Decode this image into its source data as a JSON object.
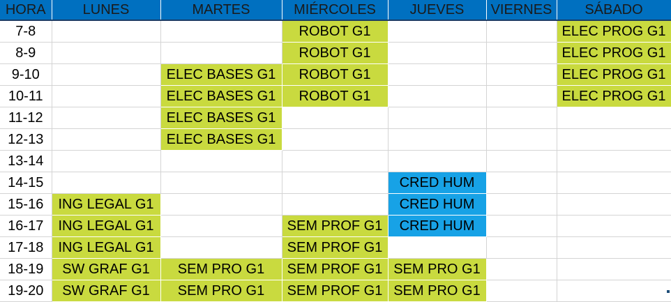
{
  "colors": {
    "header": "#0070c0",
    "green": "#c9da3f",
    "blue": "#17a2e6",
    "grid": "#d4d4d4"
  },
  "columns": [
    "HORA",
    "LUNES",
    "MARTES",
    "MIÉRCOLES",
    "JUEVES",
    "VIERNES",
    "SÁBADO"
  ],
  "rows": [
    {
      "hour": "7-8",
      "cells": [
        {
          "t": "",
          "c": ""
        },
        {
          "t": "",
          "c": ""
        },
        {
          "t": "ROBOT G1",
          "c": "green"
        },
        {
          "t": "",
          "c": ""
        },
        {
          "t": "",
          "c": ""
        },
        {
          "t": "ELEC PROG G1",
          "c": "green"
        }
      ]
    },
    {
      "hour": "8-9",
      "cells": [
        {
          "t": "",
          "c": ""
        },
        {
          "t": "",
          "c": ""
        },
        {
          "t": "ROBOT G1",
          "c": "green"
        },
        {
          "t": "",
          "c": ""
        },
        {
          "t": "",
          "c": ""
        },
        {
          "t": "ELEC PROG G1",
          "c": "green"
        }
      ]
    },
    {
      "hour": "9-10",
      "cells": [
        {
          "t": "",
          "c": ""
        },
        {
          "t": "ELEC BASES G1",
          "c": "green"
        },
        {
          "t": "ROBOT G1",
          "c": "green"
        },
        {
          "t": "",
          "c": ""
        },
        {
          "t": "",
          "c": ""
        },
        {
          "t": "ELEC PROG G1",
          "c": "green"
        }
      ]
    },
    {
      "hour": "10-11",
      "cells": [
        {
          "t": "",
          "c": ""
        },
        {
          "t": "ELEC BASES G1",
          "c": "green"
        },
        {
          "t": "ROBOT G1",
          "c": "green"
        },
        {
          "t": "",
          "c": ""
        },
        {
          "t": "",
          "c": ""
        },
        {
          "t": "ELEC PROG G1",
          "c": "green"
        }
      ]
    },
    {
      "hour": "11-12",
      "cells": [
        {
          "t": "",
          "c": ""
        },
        {
          "t": "ELEC BASES G1",
          "c": "green"
        },
        {
          "t": "",
          "c": ""
        },
        {
          "t": "",
          "c": ""
        },
        {
          "t": "",
          "c": ""
        },
        {
          "t": "",
          "c": ""
        }
      ]
    },
    {
      "hour": "12-13",
      "cells": [
        {
          "t": "",
          "c": ""
        },
        {
          "t": "ELEC BASES G1",
          "c": "green"
        },
        {
          "t": "",
          "c": ""
        },
        {
          "t": "",
          "c": ""
        },
        {
          "t": "",
          "c": ""
        },
        {
          "t": "",
          "c": ""
        }
      ]
    },
    {
      "hour": "13-14",
      "cells": [
        {
          "t": "",
          "c": ""
        },
        {
          "t": "",
          "c": ""
        },
        {
          "t": "",
          "c": ""
        },
        {
          "t": "",
          "c": ""
        },
        {
          "t": "",
          "c": ""
        },
        {
          "t": "",
          "c": ""
        }
      ]
    },
    {
      "hour": "14-15",
      "cells": [
        {
          "t": "",
          "c": ""
        },
        {
          "t": "",
          "c": ""
        },
        {
          "t": "",
          "c": ""
        },
        {
          "t": "CRED HUM",
          "c": "blue"
        },
        {
          "t": "",
          "c": ""
        },
        {
          "t": "",
          "c": ""
        }
      ]
    },
    {
      "hour": "15-16",
      "cells": [
        {
          "t": "ING LEGAL G1",
          "c": "green"
        },
        {
          "t": "",
          "c": ""
        },
        {
          "t": "",
          "c": ""
        },
        {
          "t": "CRED HUM",
          "c": "blue"
        },
        {
          "t": "",
          "c": ""
        },
        {
          "t": "",
          "c": ""
        }
      ]
    },
    {
      "hour": "16-17",
      "cells": [
        {
          "t": "ING LEGAL G1",
          "c": "green"
        },
        {
          "t": "",
          "c": ""
        },
        {
          "t": "SEM PROF G1",
          "c": "green"
        },
        {
          "t": "CRED HUM",
          "c": "blue"
        },
        {
          "t": "",
          "c": ""
        },
        {
          "t": "",
          "c": ""
        }
      ]
    },
    {
      "hour": "17-18",
      "cells": [
        {
          "t": "ING LEGAL G1",
          "c": "green"
        },
        {
          "t": "",
          "c": ""
        },
        {
          "t": "SEM PROF G1",
          "c": "green"
        },
        {
          "t": "",
          "c": ""
        },
        {
          "t": "",
          "c": ""
        },
        {
          "t": "",
          "c": ""
        }
      ]
    },
    {
      "hour": "18-19",
      "cells": [
        {
          "t": "SW GRAF G1",
          "c": "green"
        },
        {
          "t": "SEM PRO G1",
          "c": "green"
        },
        {
          "t": "SEM PROF G1",
          "c": "green"
        },
        {
          "t": "SEM PRO G1",
          "c": "green"
        },
        {
          "t": "",
          "c": ""
        },
        {
          "t": "",
          "c": ""
        }
      ]
    },
    {
      "hour": "19-20",
      "cells": [
        {
          "t": "SW GRAF G1",
          "c": "green"
        },
        {
          "t": "SEM PRO G1",
          "c": "green"
        },
        {
          "t": "SEM PROF G1",
          "c": "green"
        },
        {
          "t": "SEM PRO G1",
          "c": "green"
        },
        {
          "t": "",
          "c": ""
        },
        {
          "t": "",
          "c": ""
        }
      ]
    }
  ]
}
